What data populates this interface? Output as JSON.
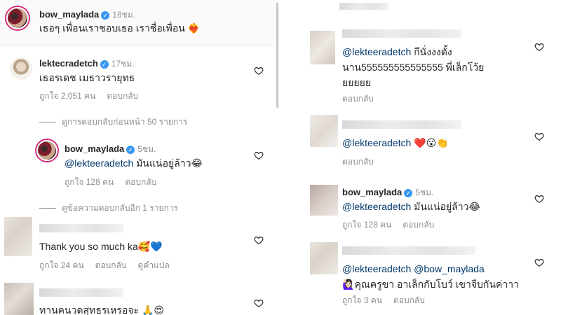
{
  "left": {
    "top_comment": {
      "username": "bow_maylada",
      "time": "18ชม.",
      "text": "เธอๆ เพื่อนเราชอบเธอ เราชื่อเพื่อน",
      "emoji": "❤️‍🔥"
    },
    "comment1": {
      "username": "lektecradetch",
      "time": "17ชม.",
      "text": "เธอรเดช เมธาวรายุทธ",
      "likes": "ถูกใจ 2,051 คน",
      "reply": "ตอบกลับ"
    },
    "view_prev_replies": "ดูการตอบกลับก่อนหน้า 50 รายการ",
    "reply1": {
      "username": "bow_maylada",
      "time": "5ชม.",
      "mention": "@lekteeradetch",
      "text": " มันแน่อยู่ล้าว",
      "emoji": "😂",
      "likes": "ถูกใจ 128 คน",
      "reply": "ตอบกลับ"
    },
    "view_more_replies": "ดูข้อความตอบกลับอีก 1 รายการ",
    "comment2": {
      "text": "Thank you so much ka",
      "emoji": "🥰💙",
      "likes": "ถูกใจ 24 คน",
      "reply": "ตอบกลับ",
      "translate": "ดูคำแปล"
    },
    "comment3": {
      "text": "ทานคนวดสุทธรเหรอจะ",
      "emoji": "🙏😍"
    }
  },
  "right": {
    "comment_a": {
      "mention": "@lekteeradetch",
      "text_line1": " กีนั่งงงตั้ง",
      "text_line2": "นาน555555555555555 พี่เล็กโว้ย",
      "text_line3": "ยยยยย",
      "reply": "ตอบกลับ"
    },
    "comment_b": {
      "mention": "@lekteeradetch",
      "emoji": "❤️😮👏",
      "reply": "ตอบกลับ"
    },
    "comment_c": {
      "username": "bow_maylada",
      "time": "5ชม.",
      "mention": "@lekteeradetch",
      "text": " มันแน่อยู่ล้าว",
      "emoji": "😂",
      "likes": "ถูกใจ 128 คน",
      "reply": "ตอบกลับ"
    },
    "comment_d": {
      "mention1": "@lekteeradetch",
      "mention2": "@bow_maylada",
      "emoji": "🙋🏻‍♀️",
      "text": "คุณครูขา อาเล็กกับโบว์ เขาจีบกันค่าาา",
      "likes": "ถูกใจ 3 คน",
      "reply": "ตอบกลับ"
    }
  },
  "colors": {
    "text": "#262626",
    "secondary": "#8e8e8e",
    "mention": "#00376b",
    "verified": "#3897f0"
  },
  "icons": [
    "heart-icon",
    "verified-icon"
  ]
}
